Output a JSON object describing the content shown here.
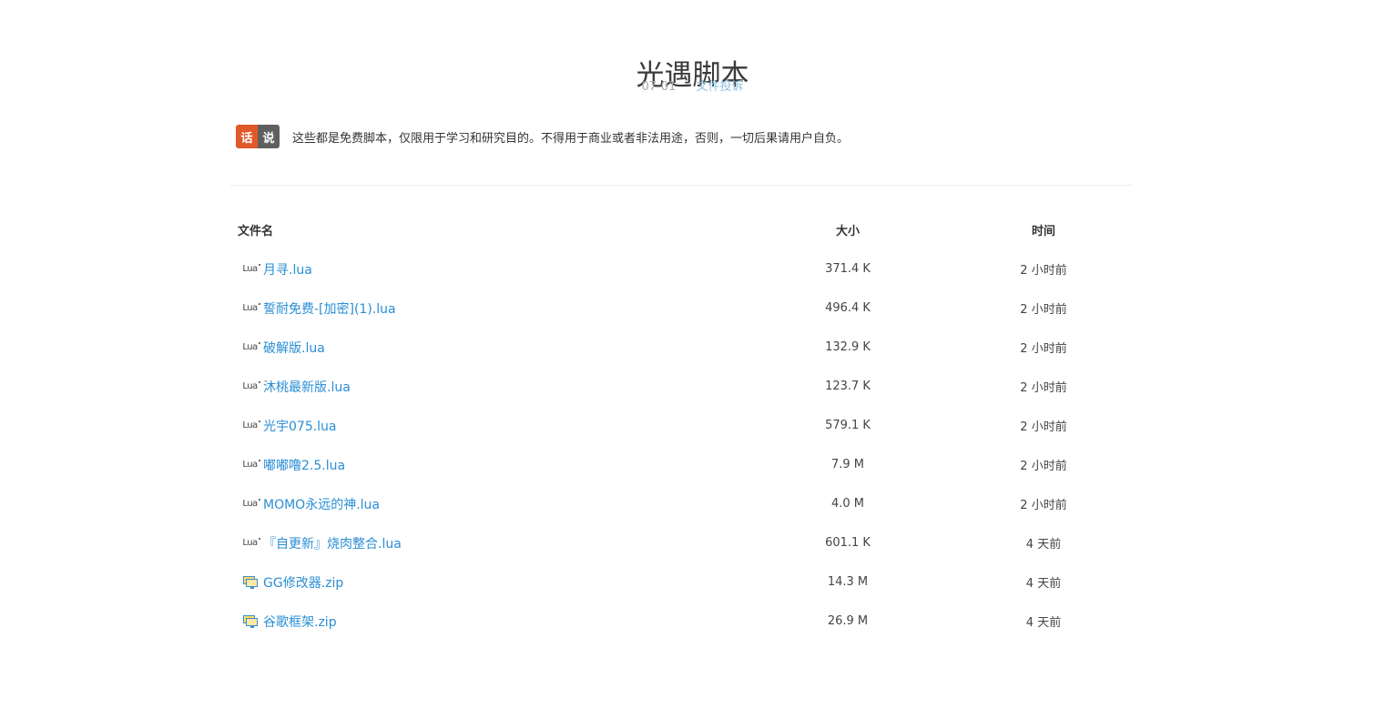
{
  "header": {
    "title": "光遇脚本",
    "date": "07-01",
    "report_link": "文件投诉"
  },
  "notice": {
    "badge_left": "话",
    "badge_right": "说",
    "text": "这些都是免费脚本，仅限用于学习和研究目的。不得用于商业或者非法用途，否则，一切后果请用户自负。"
  },
  "table": {
    "headers": {
      "name": "文件名",
      "size": "大小",
      "time": "时间"
    },
    "rows": [
      {
        "icon": "lua-file-icon",
        "name": "月寻.lua",
        "size": "371.4 K",
        "time": "2 小时前"
      },
      {
        "icon": "lua-file-icon",
        "name": "誓耐免费-[加密](1).lua",
        "size": "496.4 K",
        "time": "2 小时前"
      },
      {
        "icon": "lua-file-icon",
        "name": "破解版.lua",
        "size": "132.9 K",
        "time": "2 小时前"
      },
      {
        "icon": "lua-file-icon",
        "name": "沐桃最新版.lua",
        "size": "123.7 K",
        "time": "2 小时前"
      },
      {
        "icon": "lua-file-icon",
        "name": "光宇075.lua",
        "size": "579.1 K",
        "time": "2 小时前"
      },
      {
        "icon": "lua-file-icon",
        "name": "嘟嘟噜2.5.lua",
        "size": "7.9 M",
        "time": "2 小时前"
      },
      {
        "icon": "lua-file-icon",
        "name": "MOMO永远的神.lua",
        "size": "4.0 M",
        "time": "2 小时前"
      },
      {
        "icon": "lua-file-icon",
        "name": "『自更新』烧肉整合.lua",
        "size": "601.1 K",
        "time": "4 天前"
      },
      {
        "icon": "zip-file-icon",
        "name": "GG修改器.zip",
        "size": "14.3 M",
        "time": "4 天前"
      },
      {
        "icon": "zip-file-icon",
        "name": "谷歌框架.zip",
        "size": "26.9 M",
        "time": "4 天前"
      }
    ]
  },
  "colors": {
    "link": "#2a8ed5",
    "badge_left": "#e0592a",
    "badge_right": "#5f5f5f",
    "meta_link": "#8fc3e4"
  }
}
